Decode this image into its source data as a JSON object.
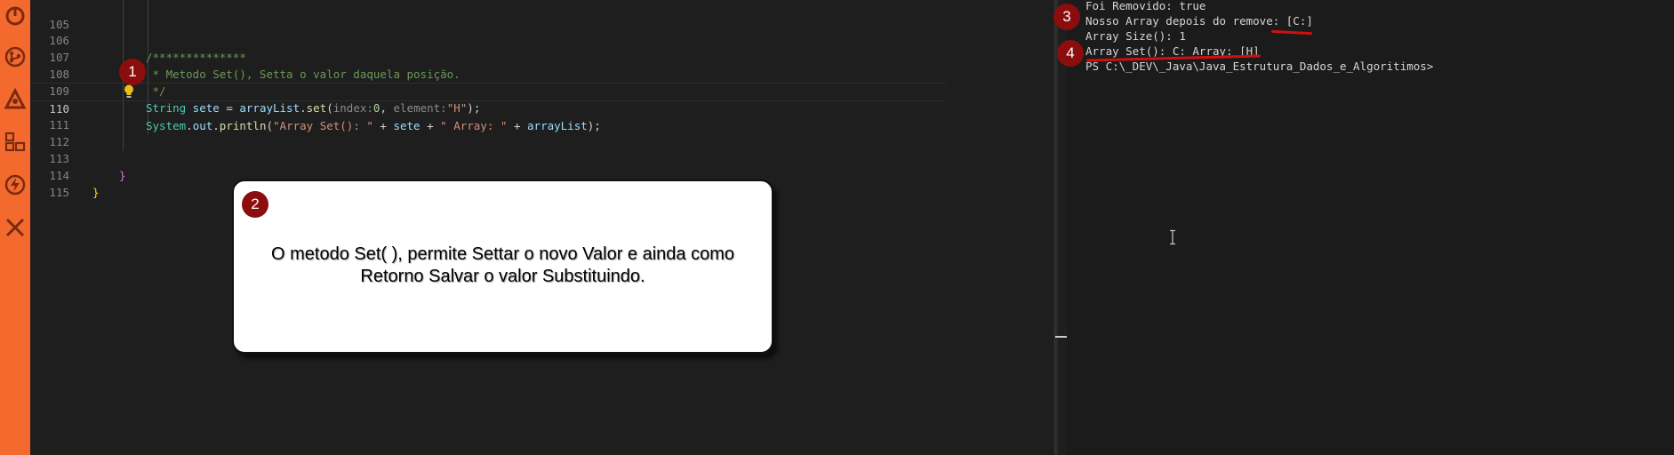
{
  "activity_bar": {
    "icons": [
      "power-icon",
      "git-graph-icon",
      "triangle-logo-icon",
      "extensions-icon",
      "lightning-icon",
      "close-icon"
    ]
  },
  "editor": {
    "lines": [
      {
        "number": "105",
        "text": ""
      },
      {
        "number": "106",
        "text": "/**************"
      },
      {
        "number": "107",
        "text": " * Metodo Set(), Setta o valor daquela posição."
      },
      {
        "number": "108",
        "text": " */"
      },
      {
        "number": "109",
        "text": "String sete = arrayList.set(index:0, element:\"H\");"
      },
      {
        "number": "110",
        "text": "System.out.println(\"Array Set(): \" + sete + \" Array: \" + arrayList);"
      },
      {
        "number": "111",
        "text": ""
      },
      {
        "number": "112",
        "text": ""
      },
      {
        "number": "113",
        "text": "}"
      },
      {
        "number": "114",
        "text": "}"
      },
      {
        "number": "115",
        "text": ""
      }
    ],
    "tokens": {
      "l106": "/**************",
      "l107": " * Metodo Set(), Setta o valor daquela posição.",
      "l108": " */",
      "l109_type": "String",
      "l109_var": " sete ",
      "l109_eq": "= ",
      "l109_obj": "arrayList",
      "l109_dot": ".",
      "l109_fn": "set",
      "l109_open": "(",
      "l109_hint1": "index:",
      "l109_num": "0",
      "l109_comma": ", ",
      "l109_hint2": "element:",
      "l109_str": "\"H\"",
      "l109_close": ");",
      "l110_sys": "System",
      "l110_dot1": ".",
      "l110_out": "out",
      "l110_dot2": ".",
      "l110_fn": "println",
      "l110_open": "(",
      "l110_str1": "\"Array Set(): \"",
      "l110_plus1": " + ",
      "l110_var": "sete",
      "l110_plus2": " + ",
      "l110_str2": "\" Array: \"",
      "l110_plus3": " + ",
      "l110_obj": "arrayList",
      "l110_close": ");",
      "l113": "}",
      "l114": "}"
    }
  },
  "annotations": {
    "badge_1": "1",
    "badge_2": "2",
    "badge_3": "3",
    "badge_4": "4",
    "callout_text": "O metodo Set( ), permite Settar o novo Valor e ainda como\nRetorno Salvar o valor Substituindo."
  },
  "terminal": {
    "lines": [
      "Foi Removido: true",
      "Nosso Array depois do remove: [C:]",
      "Array Size(): 1",
      "Array Set(): C: Array: [H]",
      "PS C:\\_DEV\\_Java\\Java_Estrutura_Dados_e_Algoritimos>"
    ]
  },
  "colors": {
    "activity_bar": "#f46a2e",
    "badge": "#8b0d0d",
    "underline": "#d01010"
  }
}
